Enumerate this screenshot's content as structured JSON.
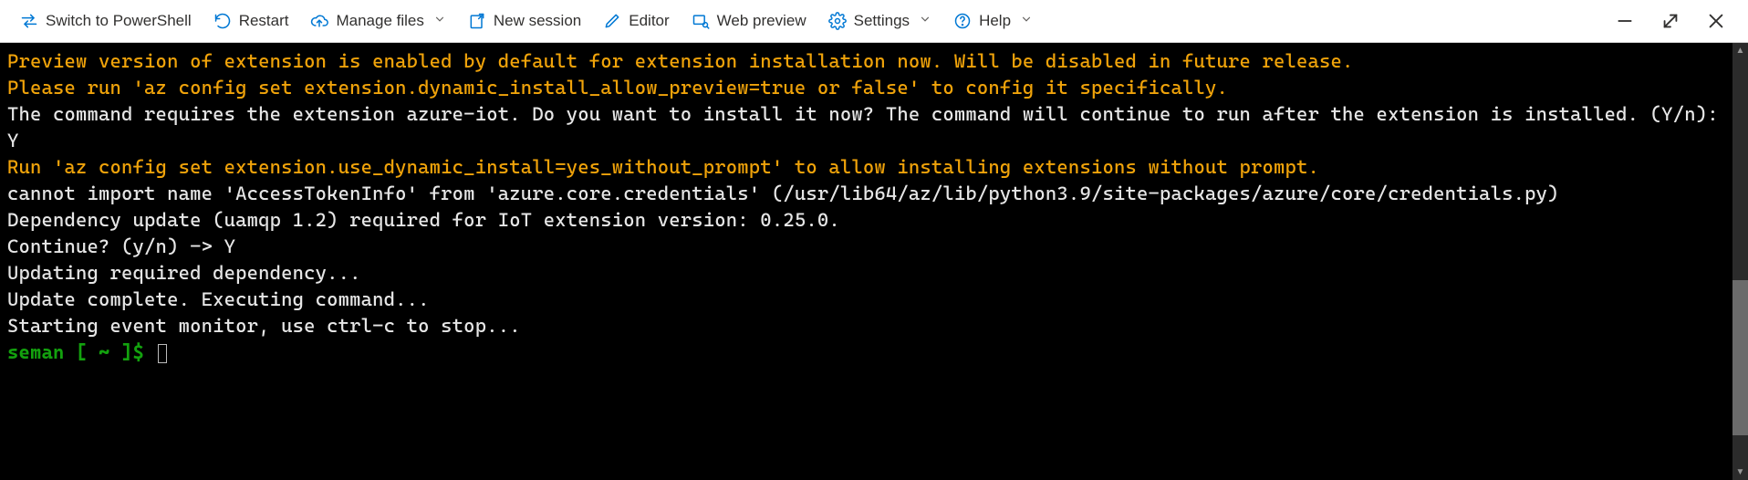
{
  "toolbar": {
    "switch_label": "Switch to PowerShell",
    "restart_label": "Restart",
    "manage_files_label": "Manage files",
    "new_session_label": "New session",
    "editor_label": "Editor",
    "web_preview_label": "Web preview",
    "settings_label": "Settings",
    "help_label": "Help"
  },
  "terminal": {
    "lines": [
      {
        "cls": "t-orange",
        "text": "Preview version of extension is enabled by default for extension installation now. Will be disabled in future release."
      },
      {
        "cls": "t-orange",
        "text": "Please run 'az config set extension.dynamic_install_allow_preview=true or false' to config it specifically."
      },
      {
        "cls": "t-white",
        "text": "The command requires the extension azure-iot. Do you want to install it now? The command will continue to run after the extension is installed. (Y/n): Y"
      },
      {
        "cls": "t-orange",
        "text": "Run 'az config set extension.use_dynamic_install=yes_without_prompt' to allow installing extensions without prompt."
      },
      {
        "cls": "t-white",
        "text": "cannot import name 'AccessTokenInfo' from 'azure.core.credentials' (/usr/lib64/az/lib/python3.9/site-packages/azure/core/credentials.py)"
      },
      {
        "cls": "t-white",
        "text": "Dependency update (uamqp 1.2) required for IoT extension version: 0.25.0."
      },
      {
        "cls": "t-white",
        "text": "Continue? (y/n) -> Y"
      },
      {
        "cls": "t-white",
        "text": "Updating required dependency..."
      },
      {
        "cls": "t-white",
        "text": "Update complete. Executing command..."
      },
      {
        "cls": "t-white",
        "text": "Starting event monitor, use ctrl-c to stop..."
      }
    ],
    "prompt_user": "seman",
    "prompt_path": " [ ~ ]$ "
  }
}
